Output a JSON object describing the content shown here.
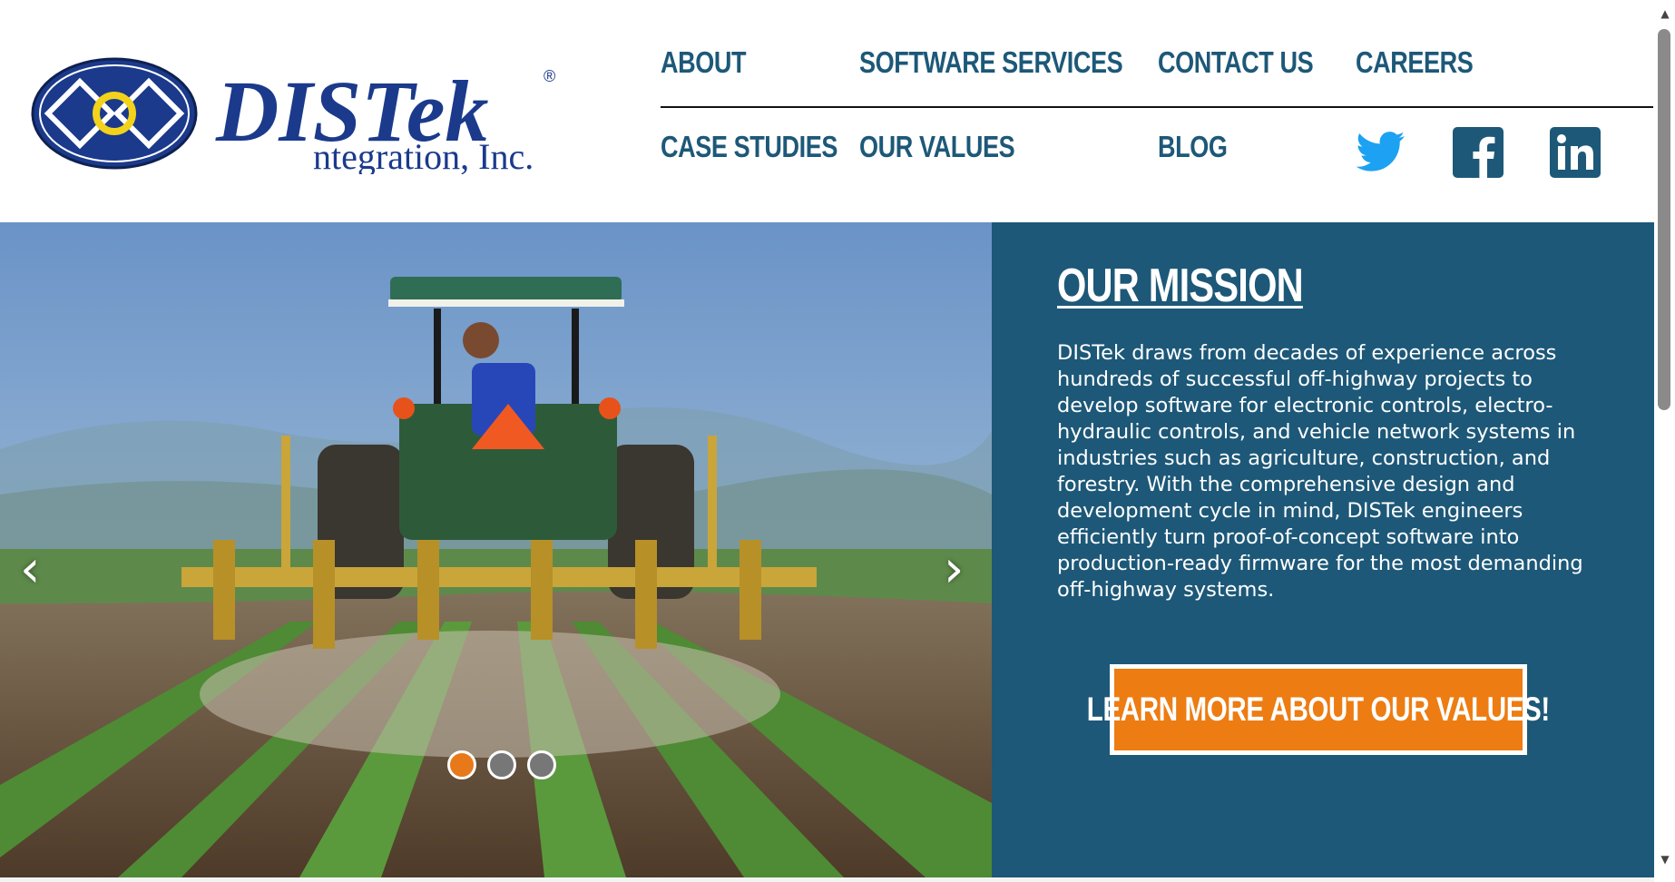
{
  "brand": {
    "name": "DISTek Integration, Inc.",
    "wordmark": "DISTek",
    "subtitle": "ntegration, Inc.",
    "registered": "®",
    "colors": {
      "primary": "#1d5878",
      "logo_blue": "#1b3a8c",
      "logo_yellow": "#f2d21b",
      "accent": "#ed7c12"
    }
  },
  "nav": {
    "items": [
      {
        "label": "ABOUT"
      },
      {
        "label": "SOFTWARE SERVICES"
      },
      {
        "label": "CONTACT US"
      },
      {
        "label": "CAREERS"
      },
      {
        "label": "CASE STUDIES"
      },
      {
        "label": "OUR VALUES"
      },
      {
        "label": "BLOG"
      }
    ],
    "social": [
      {
        "icon": "twitter-icon"
      },
      {
        "icon": "facebook-icon"
      },
      {
        "icon": "linkedin-icon"
      }
    ]
  },
  "slider": {
    "prev": "‹",
    "next": "›",
    "slide_count": 3,
    "active_slide": 1,
    "image": "tractor-cultivating-field"
  },
  "mission": {
    "title": "OUR MISSION",
    "body": "DISTek draws from decades of experience across hundreds of successful off-highway projects to develop software for electronic controls, electro-hydraulic controls, and vehicle network systems in industries such as agriculture, construction, and forestry. With the comprehensive design and development cycle in mind, DISTek engineers efficiently turn proof-of-concept software into production-ready firmware for the most demanding off-highway systems.",
    "cta_label": "LEARN MORE ABOUT OUR VALUES!"
  },
  "scrollbar": {
    "up": "▲",
    "down": "▼"
  }
}
